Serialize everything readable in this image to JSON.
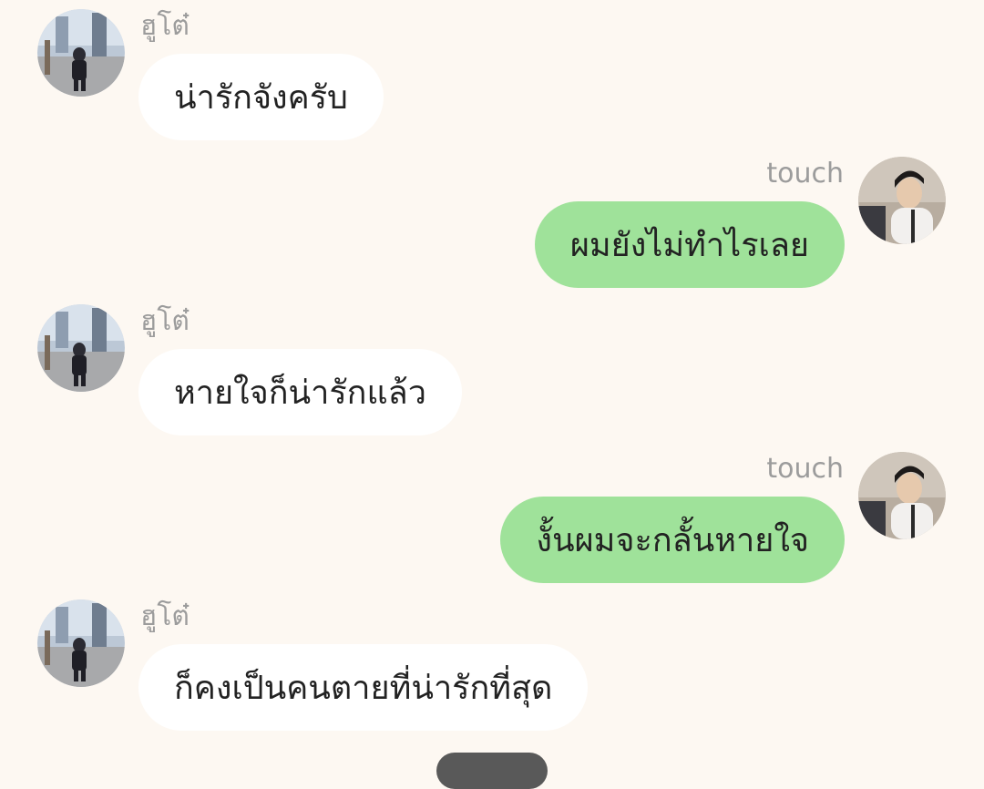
{
  "colors": {
    "background": "#fdf8f2",
    "incoming_bubble": "#ffffff",
    "outgoing_bubble": "#9fe29a",
    "sender_name": "#9c9c9c",
    "message_text": "#222222"
  },
  "messages": [
    {
      "direction": "incoming",
      "sender": "ฮูโต๋",
      "text": "น่ารักจังครับ",
      "avatar_icon": "hutoh-avatar-icon"
    },
    {
      "direction": "outgoing",
      "sender": "touch",
      "text": "ผมยังไม่ทำไรเลย",
      "avatar_icon": "touch-avatar-icon"
    },
    {
      "direction": "incoming",
      "sender": "ฮูโต๋",
      "text": "หายใจก็น่ารักแล้ว",
      "avatar_icon": "hutoh-avatar-icon"
    },
    {
      "direction": "outgoing",
      "sender": "touch",
      "text": "งั้นผมจะกลั้นหายใจ",
      "avatar_icon": "touch-avatar-icon"
    },
    {
      "direction": "incoming",
      "sender": "ฮูโต๋",
      "text": "ก็คงเป็นคนตายที่น่ารักที่สุด",
      "avatar_icon": "hutoh-avatar-icon"
    }
  ]
}
